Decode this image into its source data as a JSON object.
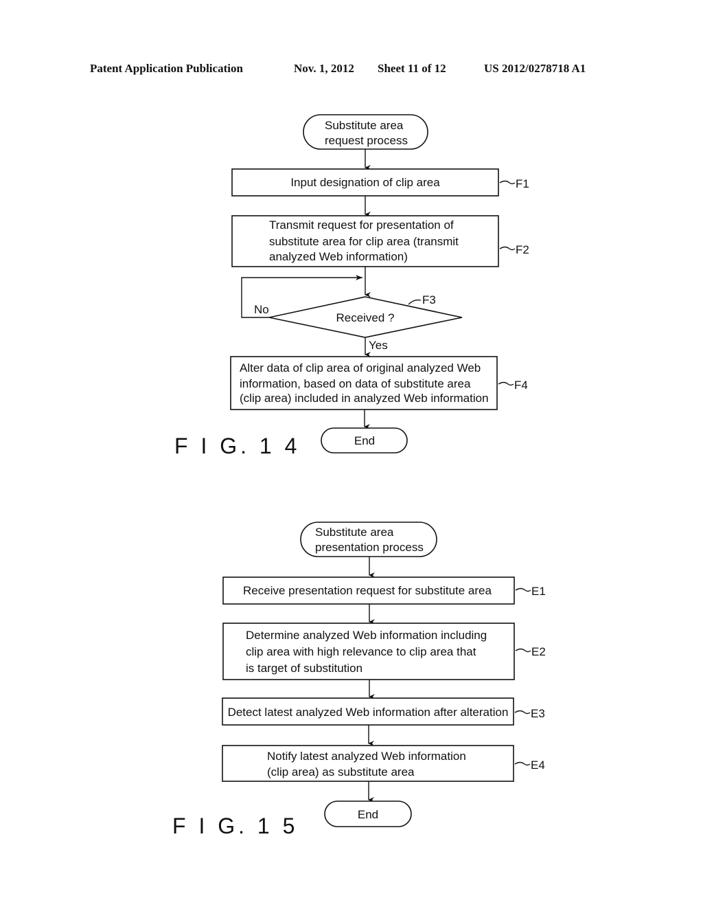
{
  "header": {
    "publication": "Patent Application Publication",
    "date": "Nov. 1, 2012",
    "sheet": "Sheet 11 of 12",
    "number": "US 2012/0278718 A1"
  },
  "fig14": {
    "label": "F I G. 1 4",
    "start": [
      "Substitute area",
      "request process"
    ],
    "steps": [
      {
        "id": "F1",
        "lines": [
          "Input designation of clip area"
        ]
      },
      {
        "id": "F2",
        "lines": [
          "Transmit request for presentation of",
          "substitute area for clip area (transmit",
          "analyzed Web information)"
        ]
      },
      {
        "id": "F4",
        "lines": [
          "Alter data of clip area of original analyzed Web",
          "information, based on data of substitute area",
          "(clip area) included in analyzed Web information"
        ]
      }
    ],
    "decision": {
      "id": "F3",
      "text": "Received ?",
      "no": "No",
      "yes": "Yes"
    },
    "end": "End"
  },
  "fig15": {
    "label": "F I G. 1 5",
    "start": [
      "Substitute area",
      "presentation process"
    ],
    "steps": [
      {
        "id": "E1",
        "lines": [
          "Receive presentation request for substitute area"
        ]
      },
      {
        "id": "E2",
        "lines": [
          "Determine analyzed Web information including",
          "clip area with high relevance to clip area that",
          "is target of substitution"
        ]
      },
      {
        "id": "E3",
        "lines": [
          "Detect latest analyzed Web information after alteration"
        ]
      },
      {
        "id": "E4",
        "lines": [
          "Notify latest analyzed Web information",
          "(clip area) as substitute area"
        ]
      }
    ],
    "end": "End"
  }
}
